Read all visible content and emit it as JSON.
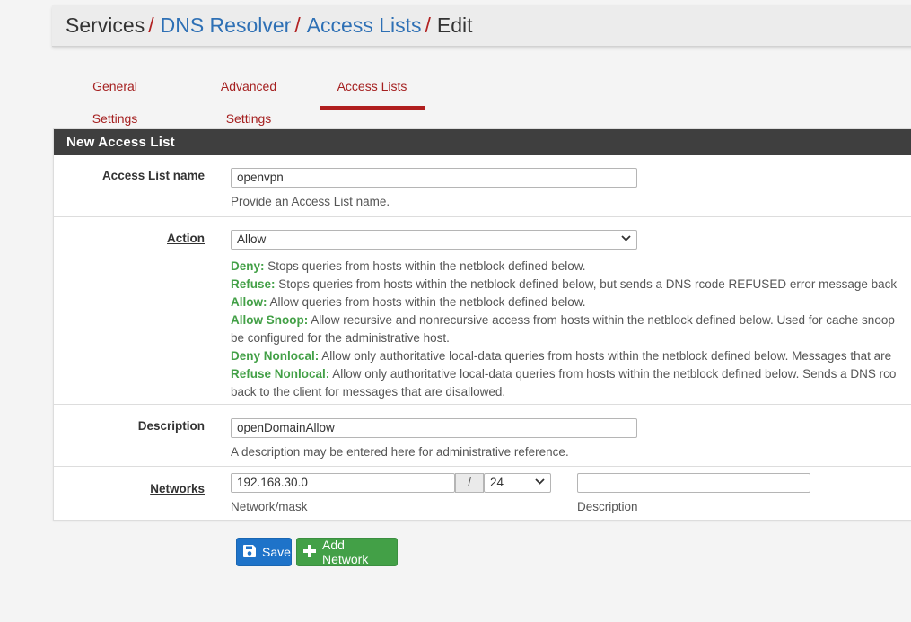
{
  "breadcrumb": [
    {
      "label": "Services",
      "link": false
    },
    {
      "label": "DNS Resolver",
      "link": true
    },
    {
      "label": "Access Lists",
      "link": true
    },
    {
      "label": "Edit",
      "link": false
    }
  ],
  "breadcrumb_separator": "/",
  "tabs": [
    {
      "label": "General Settings",
      "active": false
    },
    {
      "label": "Advanced Settings",
      "active": false
    },
    {
      "label": "Access Lists",
      "active": true
    }
  ],
  "panel": {
    "title": "New Access List",
    "name": {
      "label": "Access List name",
      "value": "openvpn",
      "help": "Provide an Access List name."
    },
    "action": {
      "label": "Action",
      "value": "Allow",
      "descriptions": [
        {
          "term": "Deny:",
          "text": "Stops queries from hosts within the netblock defined below."
        },
        {
          "term": "Refuse:",
          "text": "Stops queries from hosts within the netblock defined below, but sends a DNS rcode REFUSED error message back"
        },
        {
          "term": "Allow:",
          "text": "Allow queries from hosts within the netblock defined below."
        },
        {
          "term": "Allow Snoop:",
          "text": "Allow recursive and nonrecursive access from hosts within the netblock defined below. Used for cache snoop"
        },
        {
          "term": "",
          "text": "be configured for the administrative host."
        },
        {
          "term": "Deny Nonlocal:",
          "text": "Allow only authoritative local-data queries from hosts within the netblock defined below. Messages that are"
        },
        {
          "term": "Refuse Nonlocal:",
          "text": "Allow only authoritative local-data queries from hosts within the netblock defined below. Sends a DNS rco"
        },
        {
          "term": "",
          "text": "back to the client for messages that are disallowed."
        }
      ]
    },
    "description": {
      "label": "Description",
      "value": "openDomainAllow",
      "help": "A description may be entered here for administrative reference."
    },
    "networks": {
      "label": "Networks",
      "network_value": "192.168.30.0",
      "mask_value": "24",
      "slash": "/",
      "description_value": "",
      "network_help": "Network/mask",
      "description_help": "Description"
    }
  },
  "buttons": {
    "save": "Save",
    "add_network": "Add Network"
  },
  "colors": {
    "accent_red": "#b01e1e",
    "link_blue": "#2e70b5",
    "save_blue": "#1e73c9",
    "add_green": "#43a047",
    "term_green": "#43a047",
    "heading_dark": "#3f3f3f"
  },
  "icons": {
    "save": "floppy-disk-icon",
    "add": "plus-icon",
    "select": "chevron-down-icon"
  }
}
